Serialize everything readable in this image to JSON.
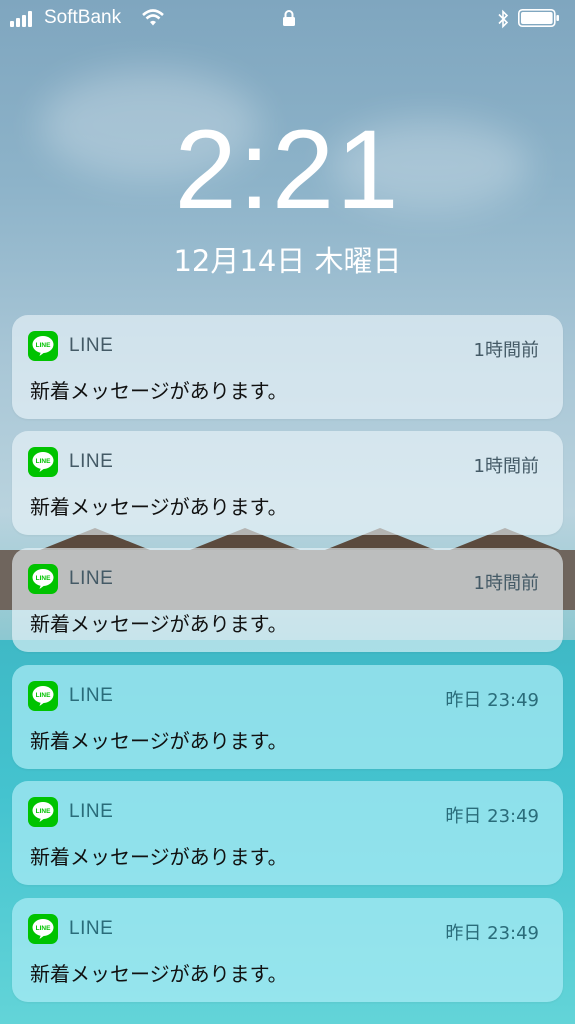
{
  "status_bar": {
    "carrier": "SoftBank",
    "signal_bars": 4,
    "wifi_icon": "wifi-icon",
    "lock_icon": "lock-icon",
    "bluetooth_icon": "bluetooth-icon",
    "battery_level": 1.0
  },
  "lockscreen": {
    "time": "2:21",
    "date": "12月14日 木曜日"
  },
  "notifications": [
    {
      "app": "LINE",
      "time": "1時間前",
      "message": "新着メッセージがあります。"
    },
    {
      "app": "LINE",
      "time": "1時間前",
      "message": "新着メッセージがあります。"
    },
    {
      "app": "LINE",
      "time": "1時間前",
      "message": "新着メッセージがあります。"
    },
    {
      "app": "LINE",
      "time": "昨日 23:49",
      "message": "新着メッセージがあります。"
    },
    {
      "app": "LINE",
      "time": "昨日 23:49",
      "message": "新着メッセージがあります。"
    },
    {
      "app": "LINE",
      "time": "昨日 23:49",
      "message": "新着メッセージがあります。"
    }
  ],
  "colors": {
    "line_brand": "#00c300"
  }
}
